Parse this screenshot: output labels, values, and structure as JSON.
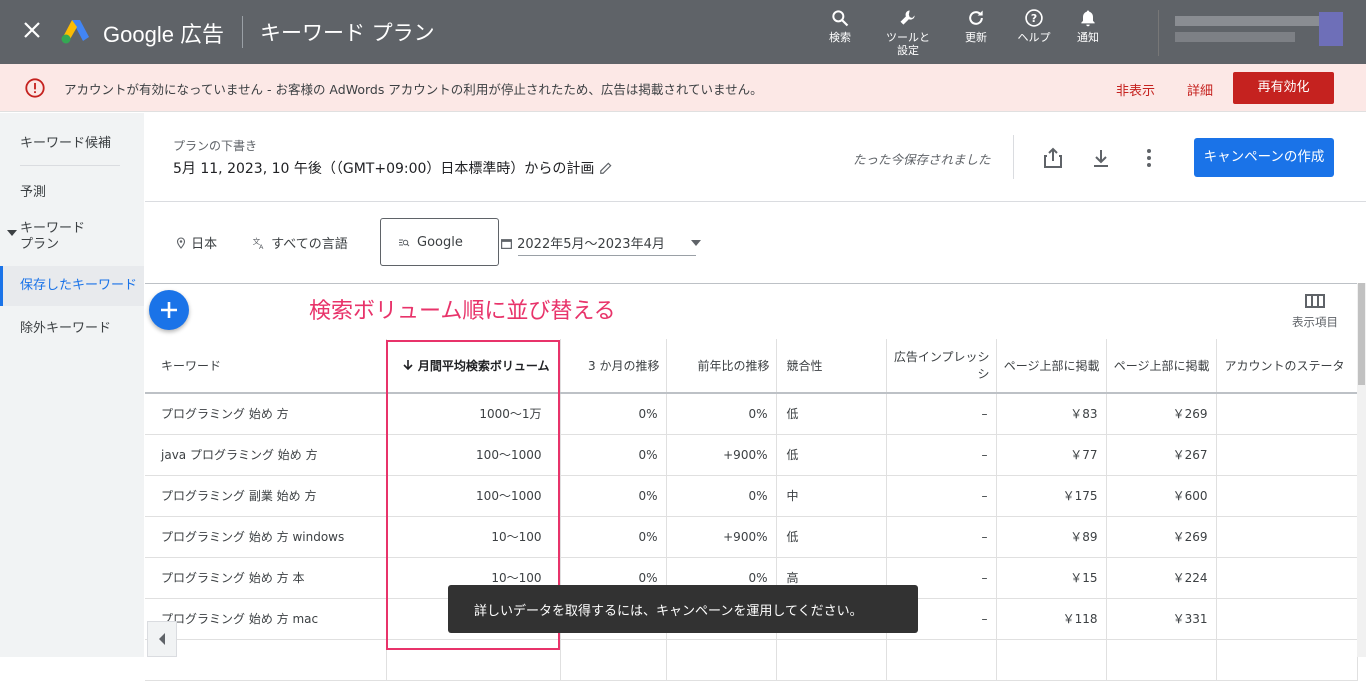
{
  "topbar": {
    "brand": "Google 広告",
    "title": "キーワード プラン",
    "tools": [
      {
        "label": "検索",
        "icon": "search-icon"
      },
      {
        "label": "ツールと設定",
        "icon": "wrench-icon"
      },
      {
        "label": "更新",
        "icon": "refresh-icon"
      },
      {
        "label": "ヘルプ",
        "icon": "help-icon"
      },
      {
        "label": "通知",
        "icon": "bell-icon"
      }
    ]
  },
  "alert": {
    "message": "アカウントが有効になっていません - お客様の AdWords アカウントの利用が停止されたため、広告は掲載されていません。",
    "hide": "非表示",
    "details": "詳細",
    "reactivate": "再有効化"
  },
  "sidebar": {
    "items": [
      {
        "label": "キーワード候補"
      },
      {
        "label": "予測"
      },
      {
        "label": "キーワード プラン"
      },
      {
        "label": "保存したキーワード"
      },
      {
        "label": "除外キーワード"
      }
    ]
  },
  "plan": {
    "label": "プランの下書き",
    "title": "5月 11, 2023, 10 午後（（GMT+09:00）日本標準時）からの計画",
    "saved": "たった今保存されました",
    "create_campaign": "キャンペーンの作成"
  },
  "filters": {
    "location": "日本",
    "language": "すべての言語",
    "network": "Google",
    "date_range": "2022年5月〜2023年4月"
  },
  "annotation": "検索ボリューム順に並び替える",
  "columns_label": "表示項目",
  "table": {
    "headers": [
      "キーワード",
      "月間平均検索ボリューム",
      "3 か月の推移",
      "前年比の推移",
      "競合性",
      "広告インプレッシ シ",
      "ページ上部に掲載",
      "ページ上部に掲載",
      "アカウントのステータ"
    ],
    "rows": [
      [
        "プログラミング 始め 方",
        "1000〜1万",
        "0%",
        "0%",
        "低",
        "–",
        "￥83",
        "￥269",
        ""
      ],
      [
        "java プログラミング 始め 方",
        "100〜1000",
        "0%",
        "+900%",
        "低",
        "–",
        "￥77",
        "￥267",
        ""
      ],
      [
        "プログラミング 副業 始め 方",
        "100〜1000",
        "0%",
        "0%",
        "中",
        "–",
        "￥175",
        "￥600",
        ""
      ],
      [
        "プログラミング 始め 方 windows",
        "10〜100",
        "0%",
        "+900%",
        "低",
        "–",
        "￥89",
        "￥269",
        ""
      ],
      [
        "プログラミング 始め 方 本",
        "10〜100",
        "0%",
        "0%",
        "高",
        "–",
        "￥15",
        "￥224",
        ""
      ],
      [
        "プログラミング 始め 方 mac",
        "",
        "",
        "",
        "",
        "–",
        "￥118",
        "￥331",
        ""
      ],
      [
        "",
        "",
        "",
        "",
        "",
        "",
        "",
        "",
        ""
      ]
    ]
  },
  "toast": "詳しいデータを取得するには、キャンペーンを運用してください。",
  "colors": {
    "topbar": "#5f6368",
    "accent": "#1a73e8",
    "alert": "#c5221f",
    "annotation": "#e8336a"
  }
}
